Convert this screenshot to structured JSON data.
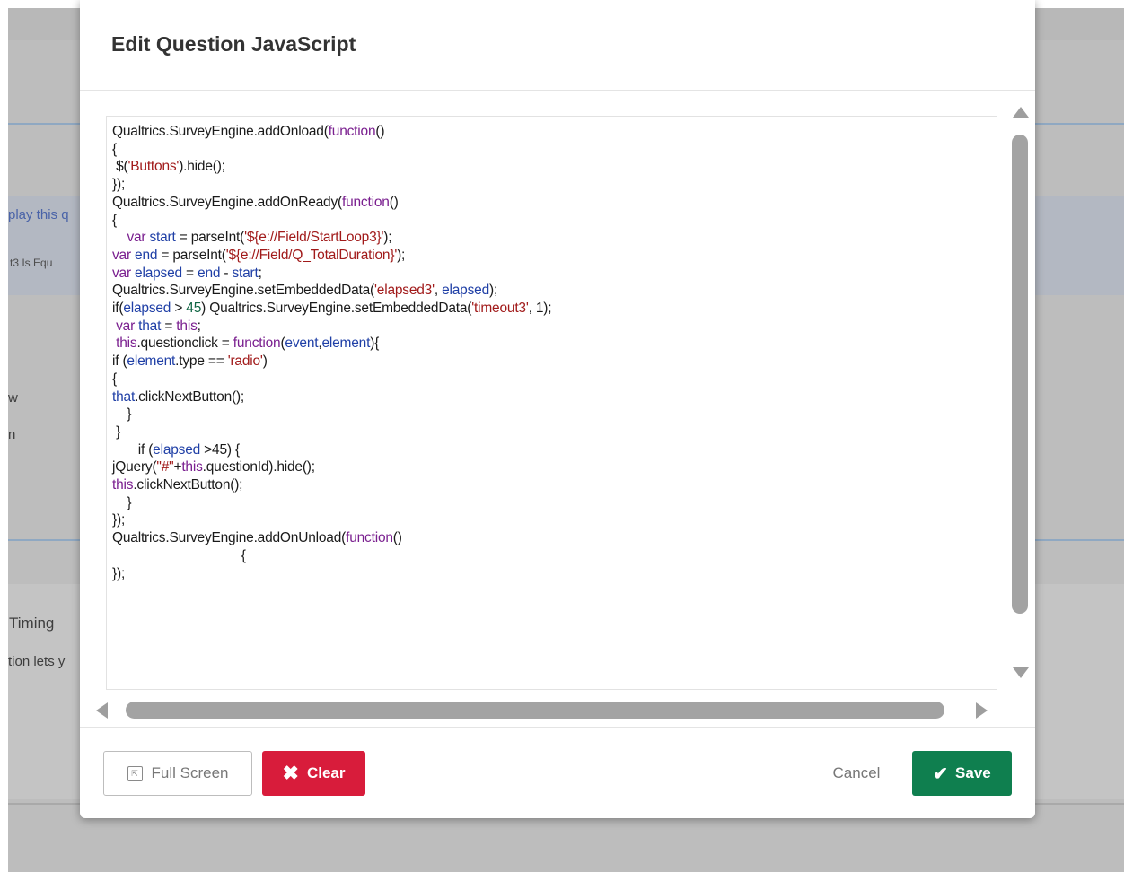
{
  "background": {
    "texts": [
      "play this q",
      "t3  Is Equ",
      "w",
      "n",
      "Timing",
      "tion lets y"
    ]
  },
  "modal": {
    "title": "Edit Question JavaScript",
    "code_lines": [
      [
        {
          "t": "Qualtrics.SurveyEngine.addOnload("
        },
        {
          "t": "function",
          "c": "kw"
        },
        {
          "t": "()"
        }
      ],
      [
        {
          "t": "{"
        }
      ],
      [
        {
          "t": " $("
        },
        {
          "t": "'Buttons'",
          "c": "str"
        },
        {
          "t": ").hide();"
        }
      ],
      [
        {
          "t": "});"
        }
      ],
      [
        {
          "t": "Qualtrics.SurveyEngine.addOnReady("
        },
        {
          "t": "function",
          "c": "kw"
        },
        {
          "t": "()"
        }
      ],
      [
        {
          "t": "{"
        }
      ],
      [
        {
          "t": "    "
        },
        {
          "t": "var",
          "c": "kw"
        },
        {
          "t": " "
        },
        {
          "t": "start",
          "c": "vr"
        },
        {
          "t": " = parseInt("
        },
        {
          "t": "'${e://Field/StartLoop3}'",
          "c": "str"
        },
        {
          "t": ");"
        }
      ],
      [
        {
          "t": "var",
          "c": "kw"
        },
        {
          "t": " "
        },
        {
          "t": "end",
          "c": "vr"
        },
        {
          "t": " = parseInt("
        },
        {
          "t": "'${e://Field/Q_TotalDuration}'",
          "c": "str"
        },
        {
          "t": ");"
        }
      ],
      [
        {
          "t": "var",
          "c": "kw"
        },
        {
          "t": " "
        },
        {
          "t": "elapsed",
          "c": "vr"
        },
        {
          "t": " = "
        },
        {
          "t": "end",
          "c": "vr"
        },
        {
          "t": " - "
        },
        {
          "t": "start",
          "c": "vr"
        },
        {
          "t": ";"
        }
      ],
      [
        {
          "t": "Qualtrics.SurveyEngine.setEmbeddedData("
        },
        {
          "t": "'elapsed3'",
          "c": "str"
        },
        {
          "t": ", "
        },
        {
          "t": "elapsed",
          "c": "vr"
        },
        {
          "t": ");"
        }
      ],
      [
        {
          "t": "if("
        },
        {
          "t": "elapsed",
          "c": "vr"
        },
        {
          "t": " > "
        },
        {
          "t": "45",
          "c": "num"
        },
        {
          "t": ") Qualtrics.SurveyEngine.setEmbeddedData("
        },
        {
          "t": "'timeout3'",
          "c": "str"
        },
        {
          "t": ", 1);"
        }
      ],
      [
        {
          "t": " "
        },
        {
          "t": "var",
          "c": "kw"
        },
        {
          "t": " "
        },
        {
          "t": "that",
          "c": "vr"
        },
        {
          "t": " = "
        },
        {
          "t": "this",
          "c": "kw"
        },
        {
          "t": ";"
        }
      ],
      [
        {
          "t": " "
        },
        {
          "t": "this",
          "c": "kw"
        },
        {
          "t": ".questionclick = "
        },
        {
          "t": "function",
          "c": "kw"
        },
        {
          "t": "("
        },
        {
          "t": "event",
          "c": "vr"
        },
        {
          "t": ","
        },
        {
          "t": "element",
          "c": "vr"
        },
        {
          "t": "){"
        }
      ],
      [
        {
          "t": "if ("
        },
        {
          "t": "element",
          "c": "vr"
        },
        {
          "t": ".type == "
        },
        {
          "t": "'radio'",
          "c": "str"
        },
        {
          "t": ")"
        }
      ],
      [
        {
          "t": "{"
        }
      ],
      [
        {
          "t": "that",
          "c": "vr"
        },
        {
          "t": ".clickNextButton();"
        }
      ],
      [
        {
          "t": "    }"
        }
      ],
      [
        {
          "t": " }"
        }
      ],
      [
        {
          "t": "       if ("
        },
        {
          "t": "elapsed",
          "c": "vr"
        },
        {
          "t": " >45) {"
        }
      ],
      [
        {
          "t": "jQuery("
        },
        {
          "t": "\"#\"",
          "c": "str"
        },
        {
          "t": "+"
        },
        {
          "t": "this",
          "c": "kw"
        },
        {
          "t": ".questionId).hide();"
        }
      ],
      [
        {
          "t": "this",
          "c": "kw"
        },
        {
          "t": ".clickNextButton();"
        }
      ],
      [
        {
          "t": "    }"
        }
      ],
      [
        {
          "t": "});"
        }
      ],
      [
        {
          "t": "Qualtrics.SurveyEngine.addOnUnload("
        },
        {
          "t": "function",
          "c": "kw"
        },
        {
          "t": "()"
        }
      ],
      [
        {
          "t": "                                   {"
        }
      ],
      [
        {
          "t": "});"
        }
      ]
    ],
    "footer": {
      "fullscreen_label": "Full Screen",
      "clear_label": "Clear",
      "cancel_label": "Cancel",
      "save_label": "Save"
    }
  },
  "icons": {
    "fullscreen": "expand-icon",
    "clear": "x-icon",
    "save": "checkmark-icon"
  },
  "colors": {
    "clear_button": "#d81c3b",
    "save_button": "#0f7f4f",
    "keyword": "#7a1f8f",
    "string": "#a11a1a",
    "variable": "#1f3fa6",
    "number": "#116644"
  }
}
